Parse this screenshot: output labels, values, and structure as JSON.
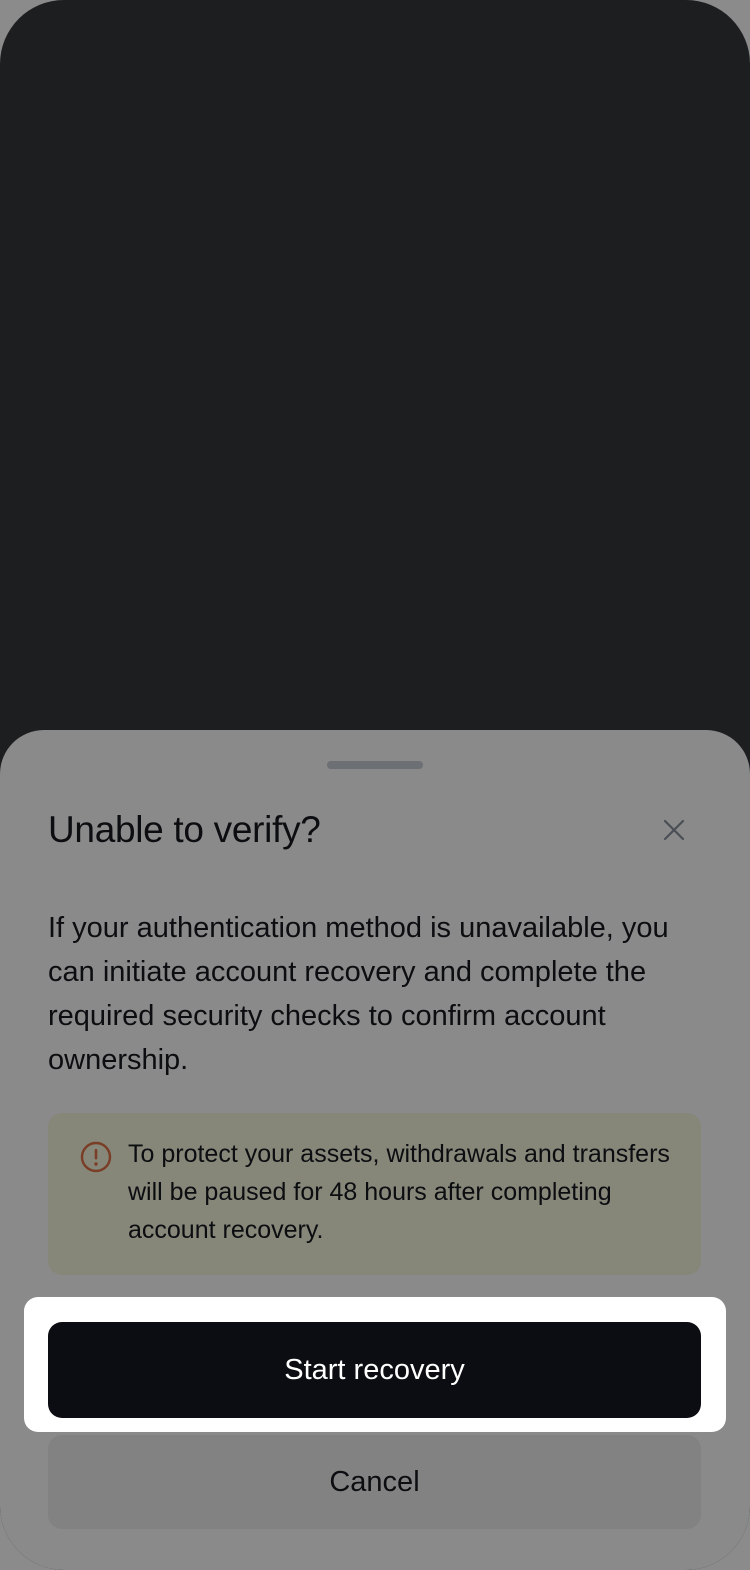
{
  "dialog": {
    "title": "Unable to verify?",
    "close_icon": "close-icon",
    "description": "If your authentication method is unavailable, you can initiate account recovery and complete the required security checks to confirm account ownership.",
    "notice": {
      "icon": "warning-circle-icon",
      "text": "To protect your assets, withdrawals and transfers will be paused for 48 hours after completing account recovery."
    },
    "primary_button": "Start recovery",
    "cancel_button": "Cancel"
  },
  "colors": {
    "backdrop": "#1d1e20",
    "sheet": "#8a8a8a",
    "primary": "#0b0d12",
    "warning_icon": "#7a3d26",
    "notice_bg": "#868679"
  }
}
